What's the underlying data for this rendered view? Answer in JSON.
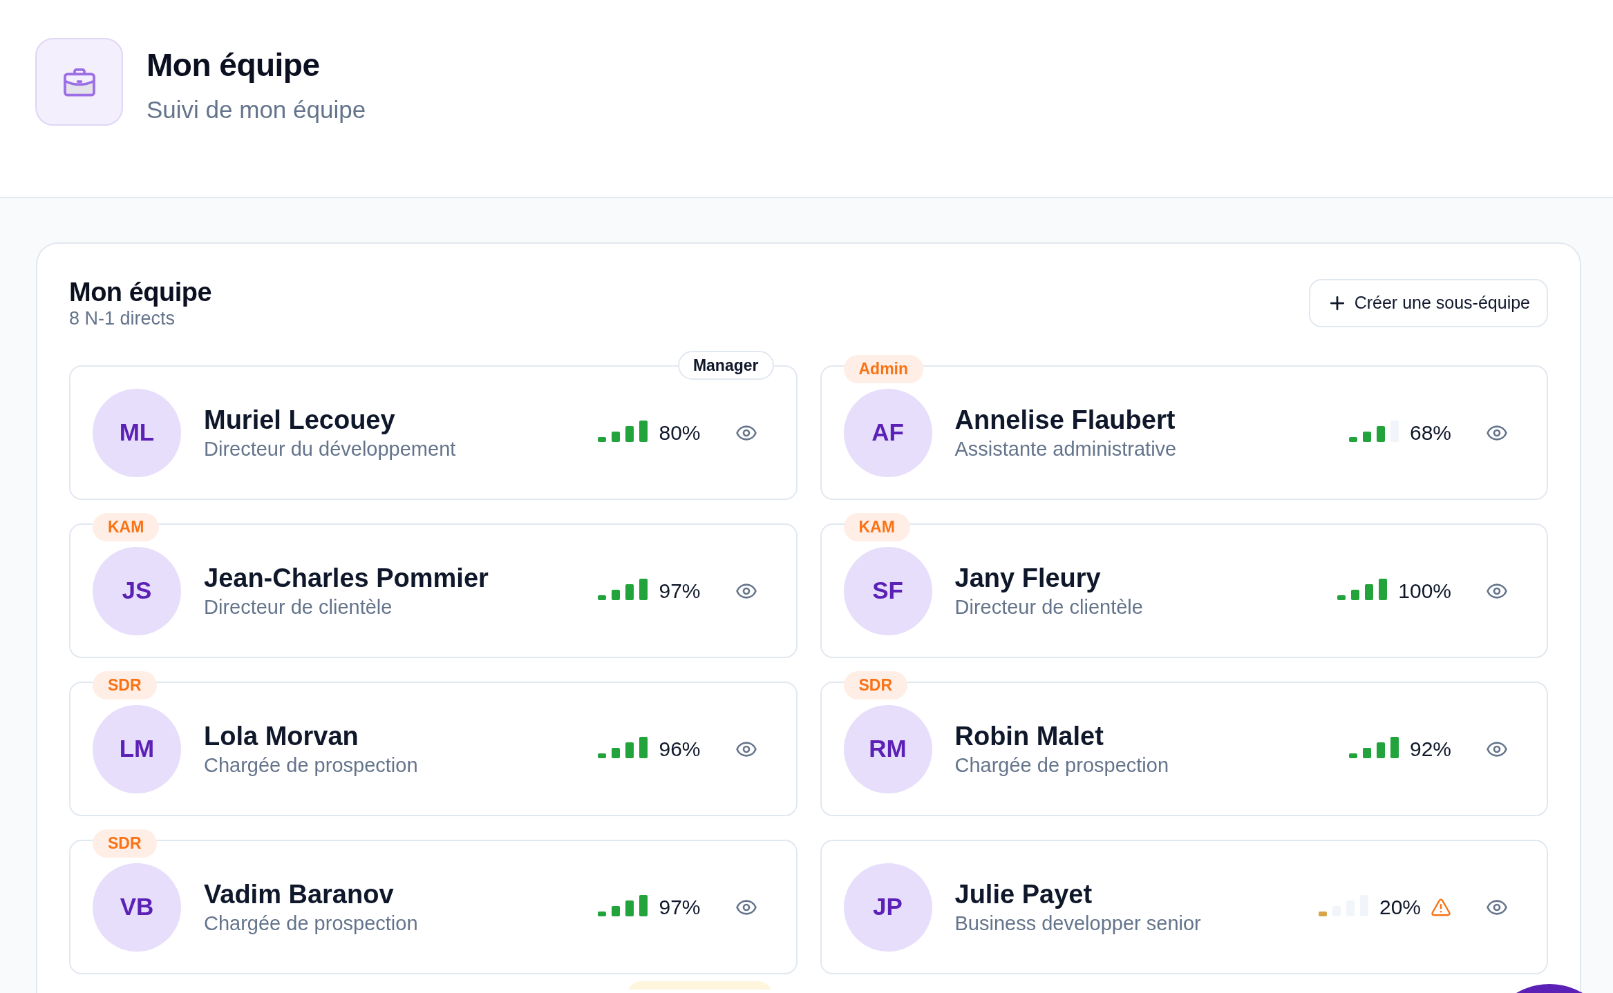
{
  "header": {
    "title": "Mon équipe",
    "subtitle": "Suivi de mon équipe"
  },
  "team": {
    "title": "Mon équipe",
    "subtitle": "8 N-1 directs",
    "create_button": {
      "label": "Créer une sous-équipe"
    },
    "members": [
      {
        "initials": "ML",
        "name": "Muriel Lecouey",
        "role": "Directeur du développement",
        "badge": {
          "label": "Manager",
          "kind": "manager"
        },
        "meter": {
          "color": "#22a33b",
          "bars": [
            {
              "on": true
            },
            {
              "on": true
            },
            {
              "on": true
            },
            {
              "on": true
            }
          ]
        },
        "score": "80%",
        "warning": false
      },
      {
        "initials": "AF",
        "name": "Annelise Flaubert",
        "role": "Assistante administrative",
        "badge": {
          "label": "Admin",
          "kind": "role"
        },
        "meter": {
          "color": "#22a33b",
          "bars": [
            {
              "on": true
            },
            {
              "on": true
            },
            {
              "on": true
            },
            {
              "on": false
            }
          ]
        },
        "score": "68%",
        "warning": false
      },
      {
        "initials": "JS",
        "name": "Jean-Charles Pommier",
        "role": "Directeur de clientèle",
        "badge": {
          "label": "KAM",
          "kind": "role"
        },
        "meter": {
          "color": "#22a33b",
          "bars": [
            {
              "on": true
            },
            {
              "on": true
            },
            {
              "on": true
            },
            {
              "on": true
            }
          ]
        },
        "score": "97%",
        "warning": false
      },
      {
        "initials": "SF",
        "name": "Jany Fleury",
        "role": "Directeur de clientèle",
        "badge": {
          "label": "KAM",
          "kind": "role"
        },
        "meter": {
          "color": "#22a33b",
          "bars": [
            {
              "on": true
            },
            {
              "on": true
            },
            {
              "on": true
            },
            {
              "on": true
            }
          ]
        },
        "score": "100%",
        "warning": false
      },
      {
        "initials": "LM",
        "name": "Lola Morvan",
        "role": "Chargée de prospection",
        "badge": {
          "label": "SDR",
          "kind": "role"
        },
        "meter": {
          "color": "#22a33b",
          "bars": [
            {
              "on": true
            },
            {
              "on": true
            },
            {
              "on": true
            },
            {
              "on": true
            }
          ]
        },
        "score": "96%",
        "warning": false
      },
      {
        "initials": "RM",
        "name": "Robin Malet",
        "role": "Chargée de prospection",
        "badge": {
          "label": "SDR",
          "kind": "role"
        },
        "meter": {
          "color": "#22a33b",
          "bars": [
            {
              "on": true
            },
            {
              "on": true
            },
            {
              "on": true
            },
            {
              "on": true
            }
          ]
        },
        "score": "92%",
        "warning": false
      },
      {
        "initials": "VB",
        "name": "Vadim Baranov",
        "role": "Chargée de prospection",
        "badge": {
          "label": "SDR",
          "kind": "role"
        },
        "meter": {
          "color": "#22a33b",
          "bars": [
            {
              "on": true
            },
            {
              "on": true
            },
            {
              "on": true
            },
            {
              "on": true
            }
          ]
        },
        "score": "97%",
        "warning": false
      },
      {
        "initials": "JP",
        "name": "Julie Payet",
        "role": "Business developper senior",
        "meter": {
          "color": "#d9a54a",
          "bars": [
            {
              "on": true
            },
            {
              "on": false
            },
            {
              "on": false
            },
            {
              "on": false
            }
          ]
        },
        "score": "20%",
        "warning": true
      }
    ]
  }
}
